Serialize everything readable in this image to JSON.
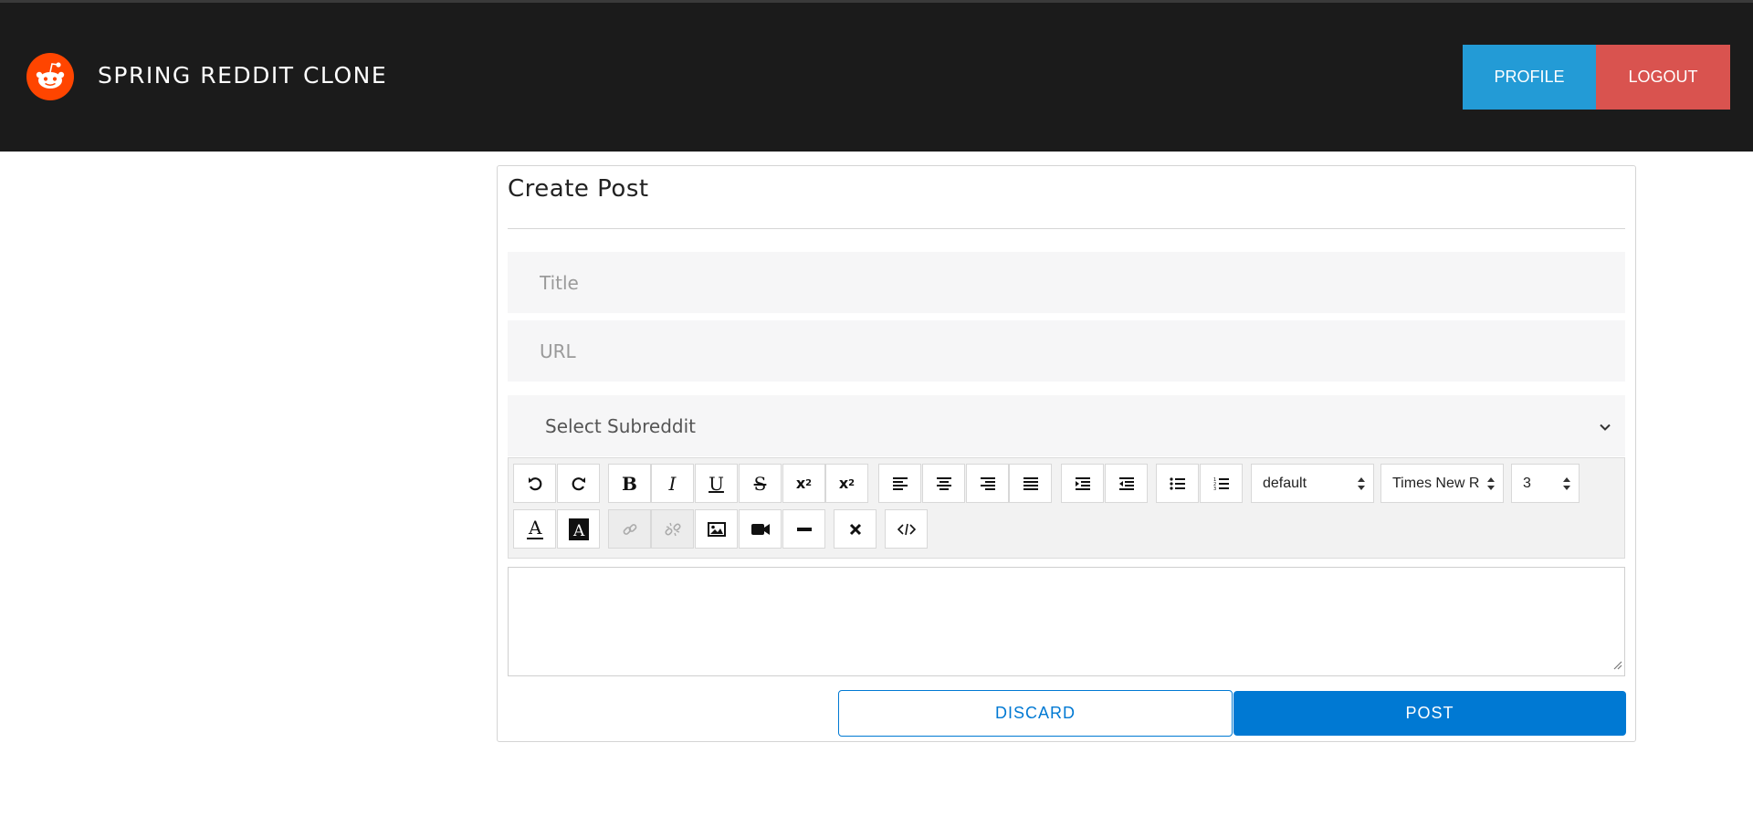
{
  "navbar": {
    "brand": "SPRING REDDIT CLONE",
    "profile_label": "PROFILE",
    "logout_label": "LOGOUT",
    "colors": {
      "background": "#1b1b1b",
      "profile": "#239bd6",
      "logout": "#d9534f",
      "logo": "#ff4500"
    }
  },
  "form": {
    "heading": "Create Post",
    "title_placeholder": "Title",
    "url_placeholder": "URL",
    "subreddit_selected": "Select Subreddit"
  },
  "toolbar": {
    "buttons_row1": [
      "undo-icon",
      "redo-icon",
      "bold-icon",
      "italic-icon",
      "underline-icon",
      "strikethrough-icon",
      "subscript-icon",
      "superscript-icon",
      "align-left-icon",
      "align-center-icon",
      "align-right-icon",
      "justify-icon",
      "indent-icon",
      "outdent-icon",
      "bullet-list-icon",
      "numbered-list-icon"
    ],
    "buttons_row2": [
      "text-color-icon",
      "background-color-icon",
      "link-icon",
      "unlink-icon",
      "image-icon",
      "video-icon",
      "horizontal-rule-icon",
      "clear-format-icon",
      "code-view-icon"
    ],
    "font_style_value": "default",
    "font_family_value": "Times New R",
    "font_size_value": "3"
  },
  "actions": {
    "discard_label": "DISCARD",
    "post_label": "POST",
    "accent": "#0079d3"
  }
}
